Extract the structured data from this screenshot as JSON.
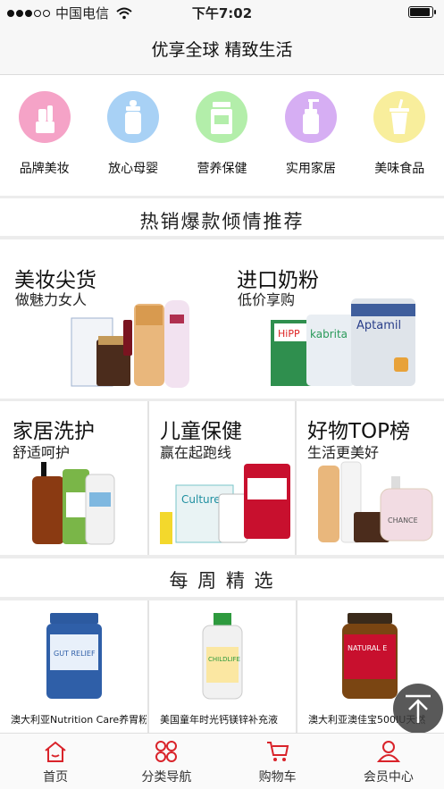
{
  "status": {
    "carrier": "中国电信",
    "time": "下午7:02"
  },
  "header": {
    "title": "优享全球 精致生活"
  },
  "categories": [
    {
      "label": "品牌美妆",
      "color": "#f5a3c7",
      "icon": "lipstick-icon"
    },
    {
      "label": "放心母婴",
      "color": "#a8d1f5",
      "icon": "baby-bottle-icon"
    },
    {
      "label": "营养保健",
      "color": "#b3eeaa",
      "icon": "supplement-jar-icon"
    },
    {
      "label": "实用家居",
      "color": "#d6aef3",
      "icon": "pump-bottle-icon"
    },
    {
      "label": "美味食品",
      "color": "#f8ee9c",
      "icon": "cup-icon"
    }
  ],
  "hot": {
    "title": "热销爆款倾情推荐",
    "tiles": [
      {
        "title": "美妆尖货",
        "subtitle": "做魅力女人"
      },
      {
        "title": "进口奶粉",
        "subtitle": "低价享购"
      },
      {
        "title": "家居洗护",
        "subtitle": "舒适呵护"
      },
      {
        "title": "儿童保健",
        "subtitle": "赢在起跑线"
      },
      {
        "title": "好物TOP榜",
        "subtitle": "生活更美好"
      }
    ]
  },
  "weekly": {
    "title": "每 周 精 选",
    "items": [
      {
        "name": "澳大利亚Nutrition Care养胃粉"
      },
      {
        "name": "美国童年时光钙镁锌补充液"
      },
      {
        "name": "澳大利亚澳佳宝500IU天然"
      }
    ]
  },
  "tabs": [
    {
      "label": "首页",
      "color": "#d9232a"
    },
    {
      "label": "分类导航",
      "color": "#d9232a"
    },
    {
      "label": "购物车",
      "color": "#d9232a"
    },
    {
      "label": "会员中心",
      "color": "#d9232a"
    }
  ]
}
